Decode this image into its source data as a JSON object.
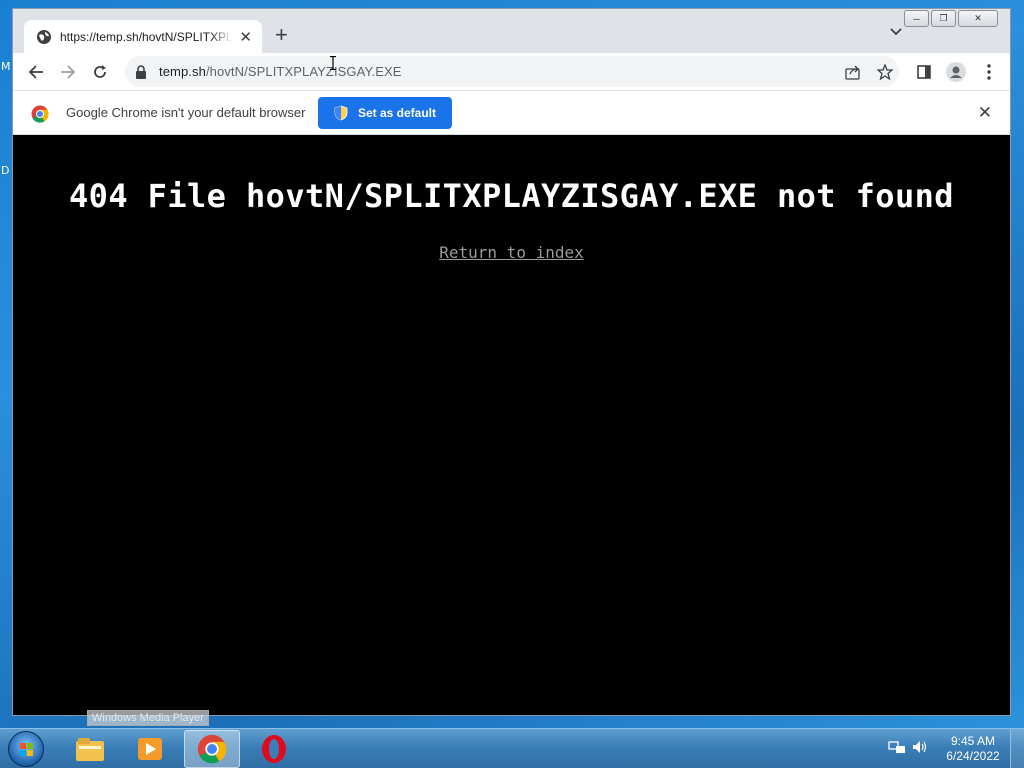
{
  "desktop": {
    "letters": [
      "M",
      "D"
    ]
  },
  "browser": {
    "tab": {
      "title": "https://temp.sh/hovtN/SPLITXPLAYZISGAY.EXE",
      "close_icon": "close-icon",
      "favicon": "globe-icon"
    },
    "new_tab_label": "+",
    "address": {
      "host": "temp.sh",
      "path": "/hovtN/SPLITXPLAYZISGAY.EXE"
    },
    "infobar": {
      "message": "Google Chrome isn't your default browser",
      "button_label": "Set as default"
    }
  },
  "page": {
    "title": "404 File hovtN/SPLITXPLAYZISGAY.EXE not found",
    "link": "Return to index"
  },
  "taskbar": {
    "tooltip": "Windows Media Player",
    "apps": [
      "file-explorer-icon",
      "media-player-icon",
      "chrome-icon",
      "opera-icon"
    ],
    "active_app": "chrome",
    "time": "9:45 AM",
    "date": "6/24/2022"
  },
  "colors": {
    "accent": "#1a73e8",
    "page_bg": "#000000",
    "title_color": "#ffffff",
    "link_color": "#9a9a9a"
  }
}
